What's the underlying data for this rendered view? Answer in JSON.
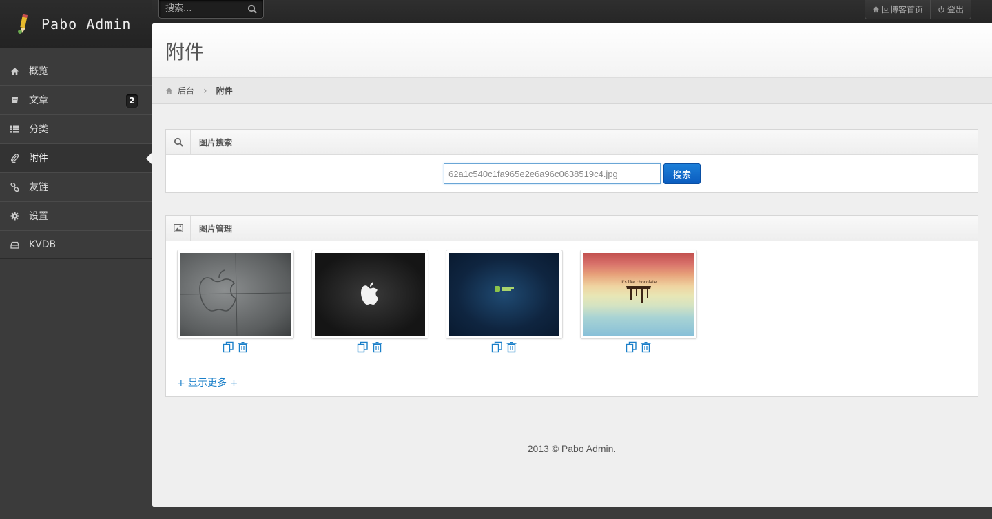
{
  "app": {
    "logo_text": "Pabo Admin"
  },
  "topbar": {
    "search_placeholder": "搜索...",
    "links": [
      {
        "label": "回博客首页",
        "icon": "home-icon"
      },
      {
        "label": "登出",
        "icon": "power-icon"
      }
    ]
  },
  "sidebar": {
    "items": [
      {
        "label": "概览",
        "icon": "home-icon"
      },
      {
        "label": "文章",
        "icon": "book-icon",
        "badge": "2"
      },
      {
        "label": "分类",
        "icon": "list-icon"
      },
      {
        "label": "附件",
        "icon": "paperclip-icon",
        "active": true
      },
      {
        "label": "友链",
        "icon": "link-icon"
      },
      {
        "label": "设置",
        "icon": "gear-icon"
      },
      {
        "label": "KVDB",
        "icon": "drive-icon"
      }
    ]
  },
  "page": {
    "title": "附件",
    "breadcrumb": {
      "home": "后台",
      "current": "附件"
    }
  },
  "image_search": {
    "title": "图片搜索",
    "input_value": "62a1c540c1fa965e2e6a96c0638519c4.jpg",
    "button_label": "搜索"
  },
  "image_manager": {
    "title": "图片管理",
    "images": [
      {
        "name": "concrete-apple-wallpaper"
      },
      {
        "name": "black-leather-apple-wallpaper"
      },
      {
        "name": "linux-mint-wallpaper"
      },
      {
        "name": "its-like-chocolate-wallpaper",
        "text": "it's like chocolate"
      }
    ],
    "show_more_label": "+ 显示更多 +"
  },
  "footer": {
    "text": "2013 © Pabo Admin."
  },
  "colors": {
    "accent": "#1a7fc9",
    "primary_button": "#0b5cbf",
    "sidebar_bg": "#3b3b3b"
  }
}
